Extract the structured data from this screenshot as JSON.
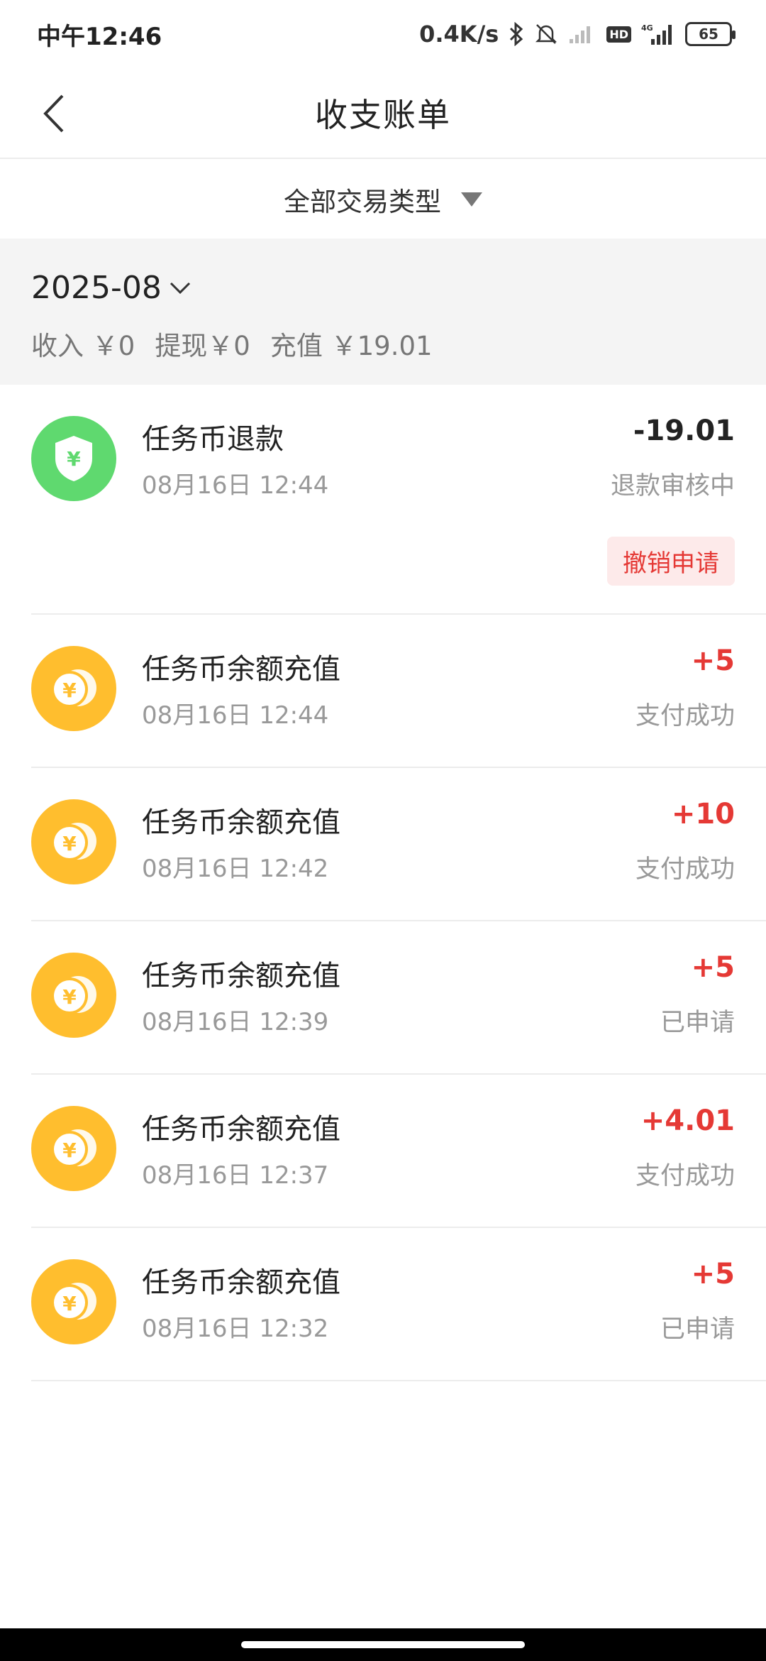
{
  "status_bar": {
    "time": "中午12:46",
    "net_speed": "0.4K/s",
    "hd": "HD",
    "network": "4G",
    "battery": "65"
  },
  "header": {
    "title": "收支账单"
  },
  "filter": {
    "label": "全部交易类型"
  },
  "summary": {
    "month": "2025-08",
    "income": "收入 ￥0",
    "withdraw": "提现￥0",
    "recharge": "充值 ￥19.01"
  },
  "transactions": [
    {
      "title": "任务币退款",
      "date": "08月16日 12:44",
      "amount": "-19.01",
      "status": "退款审核中",
      "action": "撤销申请",
      "icon": "shield-yuan-icon"
    },
    {
      "title": "任务币余额充值",
      "date": "08月16日 12:44",
      "amount": "+5",
      "status": "支付成功",
      "icon": "coins-icon"
    },
    {
      "title": "任务币余额充值",
      "date": "08月16日 12:42",
      "amount": "+10",
      "status": "支付成功",
      "icon": "coins-icon"
    },
    {
      "title": "任务币余额充值",
      "date": "08月16日 12:39",
      "amount": "+5",
      "status": "已申请",
      "icon": "coins-icon"
    },
    {
      "title": "任务币余额充值",
      "date": "08月16日 12:37",
      "amount": "+4.01",
      "status": "支付成功",
      "icon": "coins-icon"
    },
    {
      "title": "任务币余额充值",
      "date": "08月16日 12:32",
      "amount": "+5",
      "status": "已申请",
      "icon": "coins-icon"
    }
  ],
  "colors": {
    "accent_red": "#e53935",
    "coin_yellow": "#ffbe2e",
    "shield_green": "#5fd96f"
  }
}
